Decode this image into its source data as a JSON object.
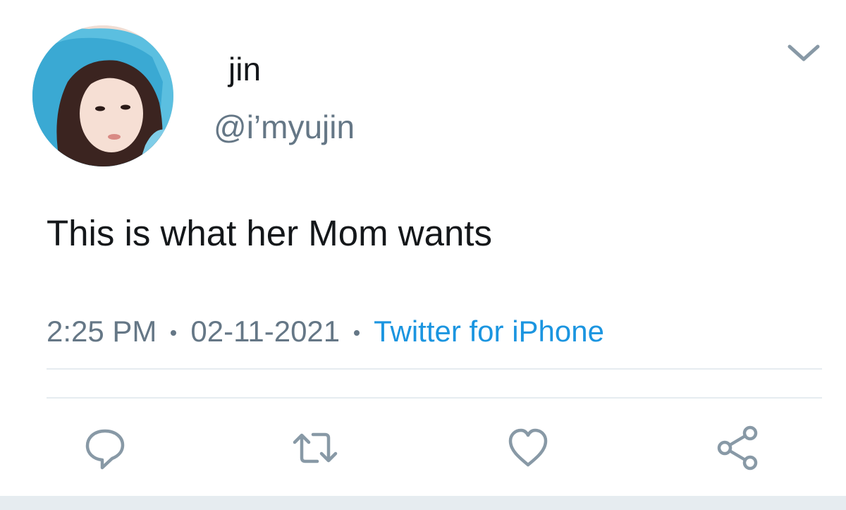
{
  "tweet": {
    "display_name": "jin",
    "handle": "@i’myujin",
    "text": "This is what her Mom wants",
    "time": "2:25 PM",
    "date": "02-11-2021",
    "source": "Twitter for iPhone"
  },
  "icons": {
    "menu": "chevron-down-icon",
    "reply": "reply-icon",
    "retweet": "retweet-icon",
    "like": "heart-icon",
    "share": "share-icon"
  },
  "colors": {
    "text": "#14171a",
    "secondary": "#657786",
    "accent": "#1b95e0",
    "divider": "#e6ecf0",
    "icon": "#8899a6"
  }
}
